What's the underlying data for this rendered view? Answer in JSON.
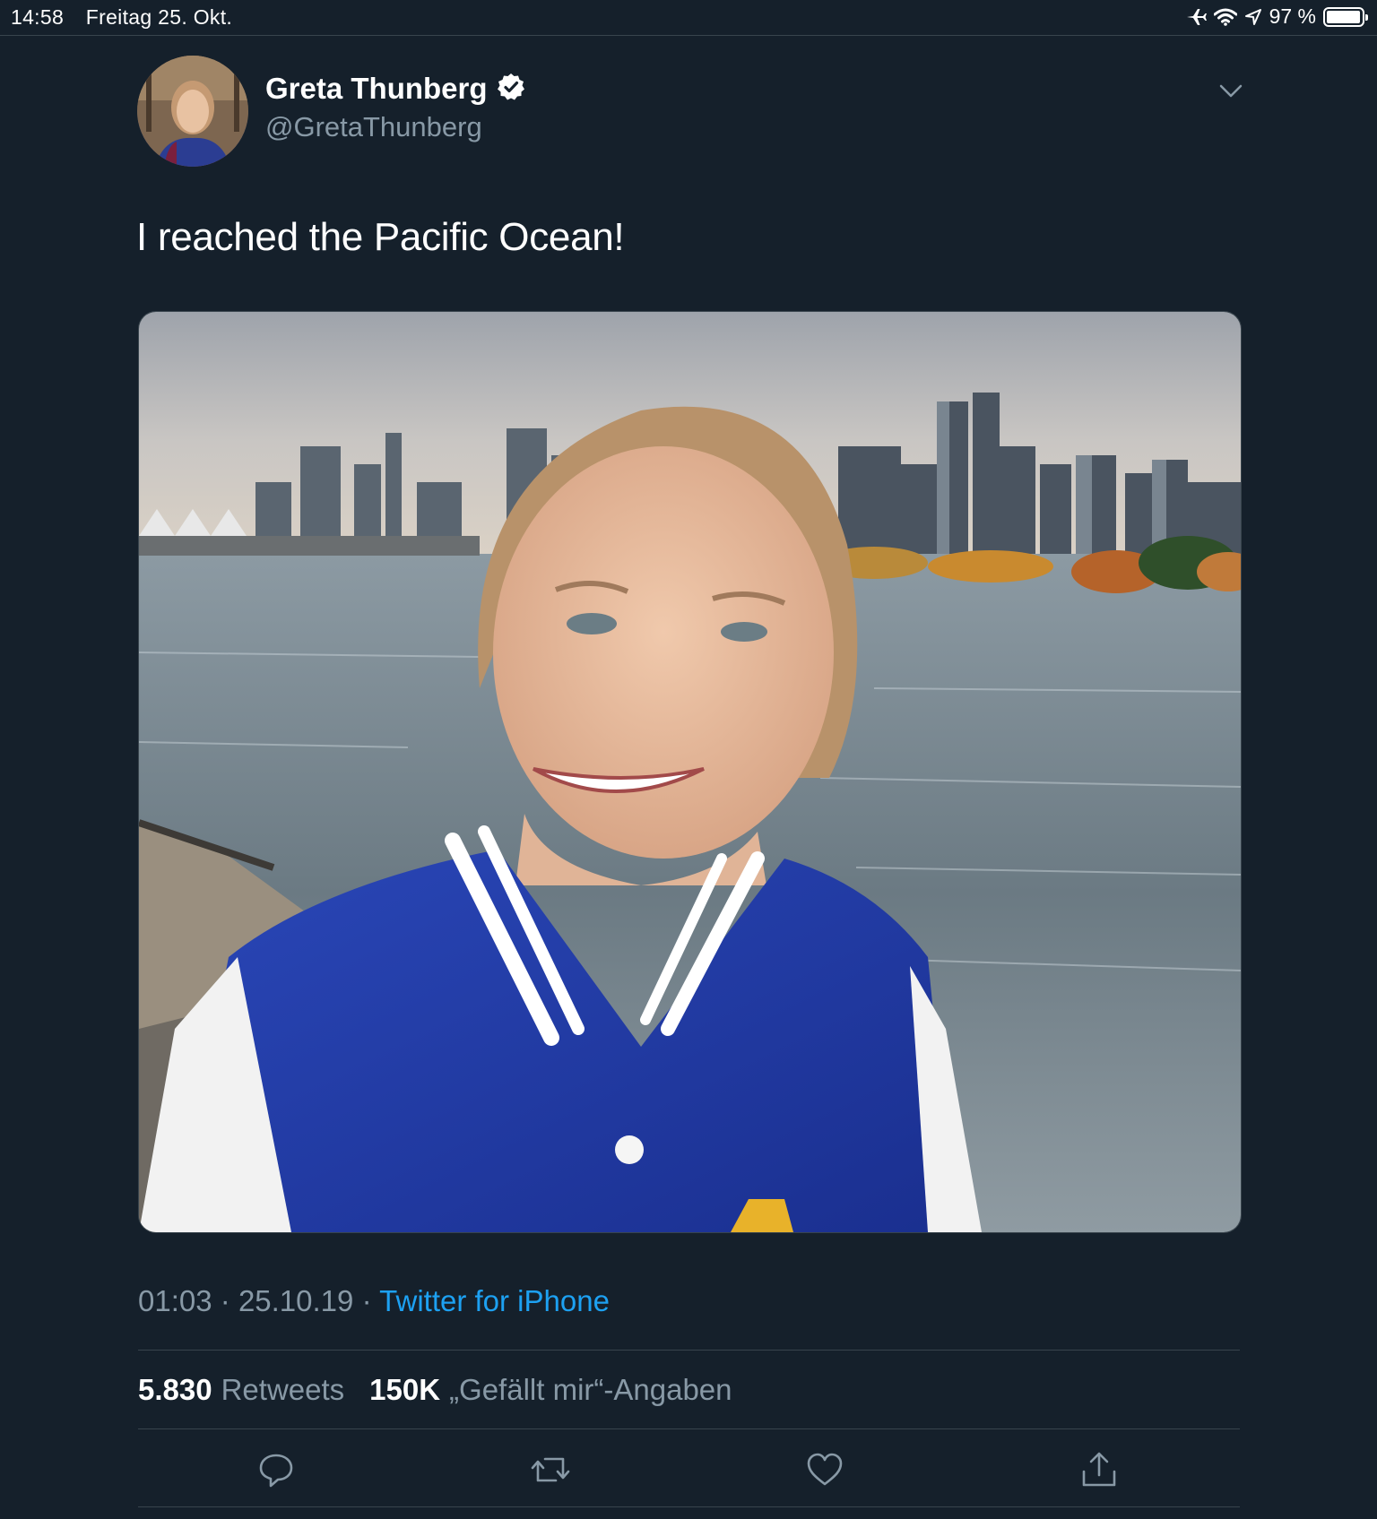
{
  "status_bar": {
    "time": "14:58",
    "date": "Freitag 25. Okt.",
    "battery": "97 %",
    "battery_level": 0.97,
    "icons": [
      "airplane-icon",
      "wifi-icon",
      "location-arrow-icon",
      "battery-icon"
    ]
  },
  "tweet": {
    "display_name": "Greta Thunberg",
    "handle": "@GretaThunberg",
    "verified": true,
    "text": "I reached the Pacific Ocean!",
    "time": "01:03",
    "date": "25.10.19",
    "separator": "·",
    "source": "Twitter for iPhone",
    "retweet_count": "5.830",
    "retweet_label": "Retweets",
    "like_count": "150K",
    "like_label": "„Gefällt mir“-Angaben"
  },
  "actions": [
    "reply-icon",
    "retweet-icon",
    "like-icon",
    "share-icon"
  ],
  "colors": {
    "background": "#15202b",
    "link": "#1da1f2",
    "muted": "#8899a6",
    "divider": "#38444d"
  }
}
